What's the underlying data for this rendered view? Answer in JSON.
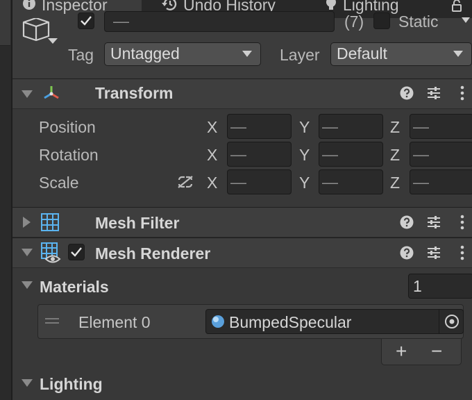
{
  "tabs": [
    {
      "label": "Inspector",
      "icon": "info-icon",
      "active": true
    },
    {
      "label": "Undo History",
      "icon": "history-icon",
      "active": false
    },
    {
      "label": "Lighting",
      "icon": "lightbulb-icon",
      "active": false
    }
  ],
  "object_header": {
    "name_value": "—",
    "count": "(7)",
    "static_label": "Static",
    "tag_label": "Tag",
    "tag_value": "Untagged",
    "layer_label": "Layer",
    "layer_value": "Default"
  },
  "transform": {
    "title": "Transform",
    "rows": [
      {
        "label": "Position",
        "x": "—",
        "y": "—",
        "z": "—"
      },
      {
        "label": "Rotation",
        "x": "—",
        "y": "—",
        "z": "—"
      },
      {
        "label": "Scale",
        "x": "—",
        "y": "—",
        "z": "—"
      }
    ],
    "axes": [
      "X",
      "Y",
      "Z"
    ]
  },
  "mesh_filter": {
    "title": "Mesh Filter"
  },
  "mesh_renderer": {
    "title": "Mesh Renderer",
    "materials_label": "Materials",
    "materials_count": "1",
    "element_label": "Element 0",
    "element_value": "BumpedSpecular",
    "add_label": "+",
    "remove_label": "−"
  },
  "lighting_section": {
    "title": "Lighting"
  },
  "colors": {
    "panel": "#3c3c3c",
    "field": "#2a2a2a",
    "material_dot": "#5aa0dc"
  }
}
